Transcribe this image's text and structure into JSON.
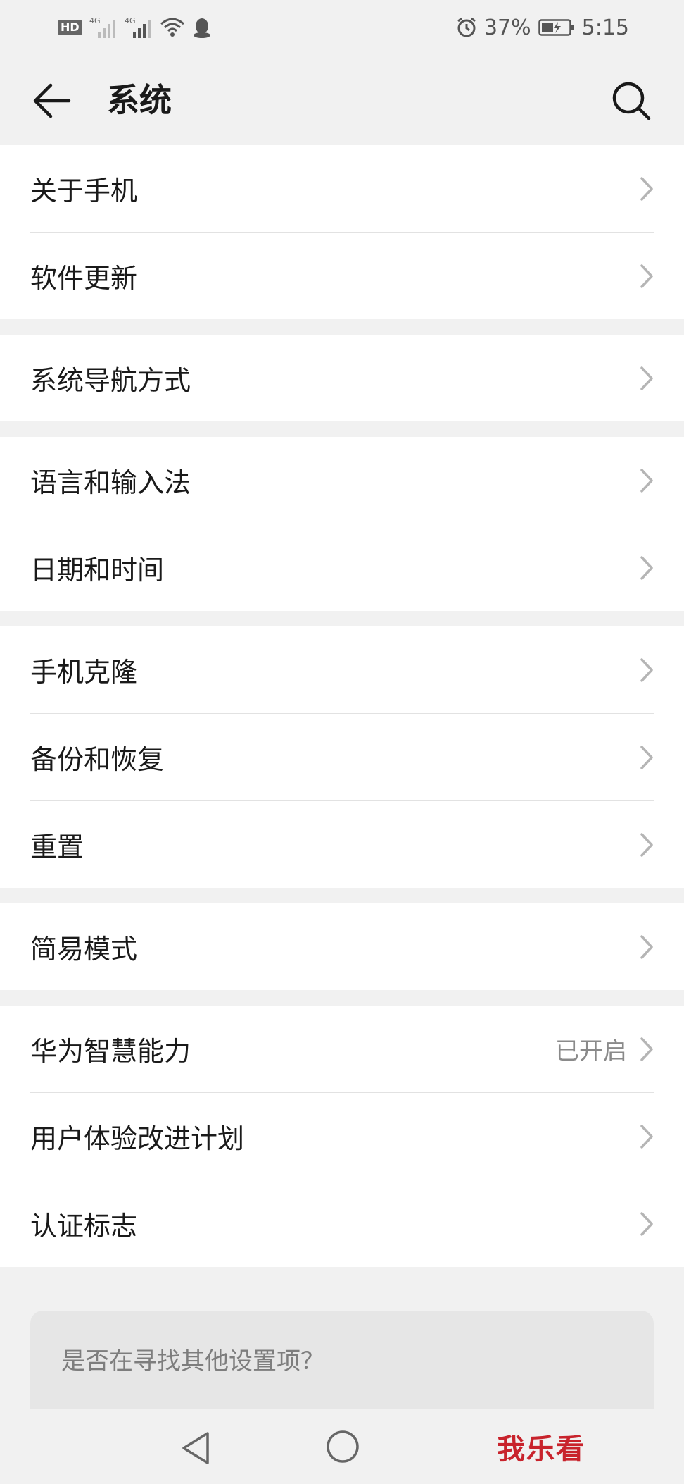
{
  "status_bar": {
    "hd_label": "HD",
    "sim1_label": "4G",
    "sim2_label": "4G",
    "battery_percent": "37%",
    "time": "5:15",
    "icons": [
      "hd-voice-icon",
      "signal-icon",
      "wifi-icon",
      "qq-icon",
      "alarm-icon",
      "battery-charging-icon"
    ]
  },
  "toolbar": {
    "title": "系统",
    "back_icon": "arrow-left-icon",
    "search_icon": "search-icon"
  },
  "groups": [
    {
      "items": [
        {
          "label": "关于手机"
        },
        {
          "label": "软件更新"
        }
      ]
    },
    {
      "items": [
        {
          "label": "系统导航方式"
        }
      ]
    },
    {
      "items": [
        {
          "label": "语言和输入法"
        },
        {
          "label": "日期和时间"
        }
      ]
    },
    {
      "items": [
        {
          "label": "手机克隆"
        },
        {
          "label": "备份和恢复"
        },
        {
          "label": "重置"
        }
      ]
    },
    {
      "items": [
        {
          "label": "简易模式"
        }
      ]
    },
    {
      "items": [
        {
          "label": "华为智慧能力",
          "value": "已开启"
        },
        {
          "label": "用户体验改进计划"
        },
        {
          "label": "认证标志"
        }
      ]
    }
  ],
  "help_card": {
    "text": "是否在寻找其他设置项？"
  },
  "nav_bar": {
    "watermark": "我乐看"
  },
  "colors": {
    "background": "#f1f1f1",
    "card": "#ffffff",
    "watermark": "#c8232c"
  }
}
